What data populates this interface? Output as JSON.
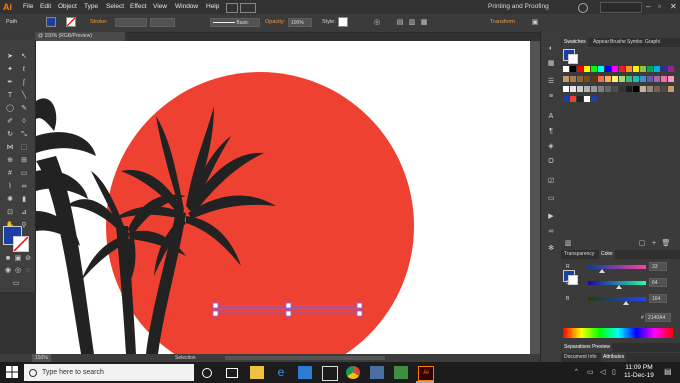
{
  "app": {
    "logo": "Ai",
    "menus": [
      "File",
      "Edit",
      "Object",
      "Type",
      "Select",
      "Effect",
      "View",
      "Window",
      "Help"
    ],
    "workspace": "Printing and Proofing"
  },
  "control": {
    "object_type": "Path",
    "stroke_label": "Stroke:",
    "stroke_style": "Basic",
    "opacity_label": "Opacity:",
    "opacity_value": "100%",
    "style_label": "Style:",
    "transform_label": "Transform",
    "fill_color": "#1c3fa3"
  },
  "document": {
    "tab": "@ 150% (RGB/Preview)"
  },
  "canvas": {
    "sun_color": "#ef4131",
    "silhouette_color": "#222222",
    "selection_color": "#6b6bff"
  },
  "status": {
    "zoom": "150%",
    "mode": "Selection"
  },
  "swatches_panel": {
    "tabs": [
      "Swatches",
      "Appear",
      "Brushe",
      "Symbo",
      "Graphi"
    ]
  },
  "color_panel": {
    "tabs": [
      "Transparency",
      "Color"
    ],
    "sliders": [
      {
        "channel": "R",
        "value": "33"
      },
      {
        "channel": "G",
        "value": "64"
      },
      {
        "channel": "B",
        "value": "164"
      }
    ],
    "hex": "2140A4"
  },
  "bottom_panels": {
    "separations": "Separations Preview",
    "doc_info": "Document Info",
    "attributes": "Attributes"
  },
  "taskbar": {
    "search_placeholder": "Type here to search",
    "time": "11:09 PM",
    "date": "11-Dec-19"
  },
  "colors": {
    "accent": "#f29a44",
    "brand": "#ff7c00"
  }
}
